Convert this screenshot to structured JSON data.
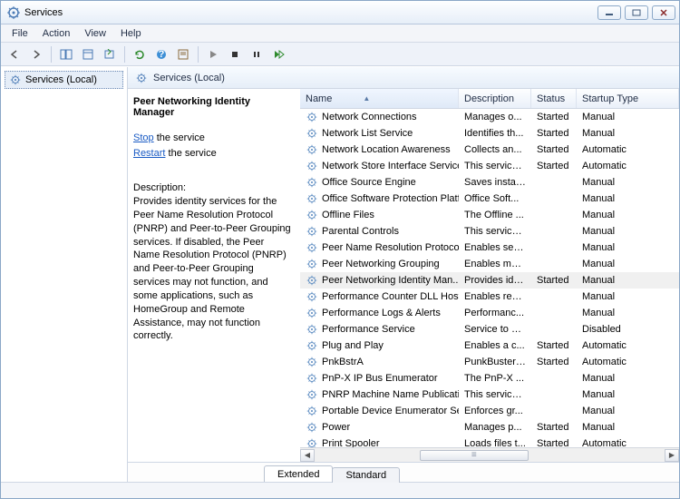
{
  "window": {
    "title": "Services"
  },
  "menu": {
    "file": "File",
    "action": "Action",
    "view": "View",
    "help": "Help"
  },
  "tree": {
    "root": "Services (Local)"
  },
  "panel_header": "Services (Local)",
  "detail": {
    "title": "Peer Networking Identity Manager",
    "stop_link": "Stop",
    "stop_suffix": " the service",
    "restart_link": "Restart",
    "restart_suffix": " the service",
    "desc_label": "Description:",
    "desc_text": "Provides identity services for the Peer Name Resolution Protocol (PNRP) and Peer-to-Peer Grouping services. If disabled, the Peer Name Resolution Protocol (PNRP) and Peer-to-Peer Grouping services may not function, and some applications, such as HomeGroup and Remote Assistance, may not function correctly."
  },
  "columns": {
    "name": "Name",
    "desc": "Description",
    "status": "Status",
    "startup": "Startup Type"
  },
  "tabs": {
    "extended": "Extended",
    "standard": "Standard"
  },
  "services": [
    {
      "name": "Network Connections",
      "desc": "Manages o...",
      "status": "Started",
      "startup": "Manual"
    },
    {
      "name": "Network List Service",
      "desc": "Identifies th...",
      "status": "Started",
      "startup": "Manual"
    },
    {
      "name": "Network Location Awareness",
      "desc": "Collects an...",
      "status": "Started",
      "startup": "Automatic"
    },
    {
      "name": "Network Store Interface Service",
      "desc": "This service ...",
      "status": "Started",
      "startup": "Automatic"
    },
    {
      "name": "Office  Source Engine",
      "desc": "Saves install...",
      "status": "",
      "startup": "Manual"
    },
    {
      "name": "Office Software Protection Platf...",
      "desc": "Office Soft...",
      "status": "",
      "startup": "Manual"
    },
    {
      "name": "Offline Files",
      "desc": "The Offline ...",
      "status": "",
      "startup": "Manual"
    },
    {
      "name": "Parental Controls",
      "desc": "This service ...",
      "status": "",
      "startup": "Manual"
    },
    {
      "name": "Peer Name Resolution Protocol",
      "desc": "Enables serv...",
      "status": "",
      "startup": "Manual"
    },
    {
      "name": "Peer Networking Grouping",
      "desc": "Enables mul...",
      "status": "",
      "startup": "Manual"
    },
    {
      "name": "Peer Networking Identity Man...",
      "desc": "Provides ide...",
      "status": "Started",
      "startup": "Manual",
      "sel": true
    },
    {
      "name": "Performance Counter DLL Host",
      "desc": "Enables rem...",
      "status": "",
      "startup": "Manual"
    },
    {
      "name": "Performance Logs & Alerts",
      "desc": "Performanc...",
      "status": "",
      "startup": "Manual"
    },
    {
      "name": "Performance Service",
      "desc": "Service to al...",
      "status": "",
      "startup": "Disabled"
    },
    {
      "name": "Plug and Play",
      "desc": "Enables a c...",
      "status": "Started",
      "startup": "Automatic"
    },
    {
      "name": "PnkBstrA",
      "desc": "PunkBuster ...",
      "status": "Started",
      "startup": "Automatic"
    },
    {
      "name": "PnP-X IP Bus Enumerator",
      "desc": "The PnP-X ...",
      "status": "",
      "startup": "Manual"
    },
    {
      "name": "PNRP Machine Name Publicati...",
      "desc": "This service ...",
      "status": "",
      "startup": "Manual"
    },
    {
      "name": "Portable Device Enumerator Ser...",
      "desc": "Enforces gr...",
      "status": "",
      "startup": "Manual"
    },
    {
      "name": "Power",
      "desc": "Manages p...",
      "status": "Started",
      "startup": "Manual"
    },
    {
      "name": "Print Spooler",
      "desc": "Loads files t...",
      "status": "Started",
      "startup": "Automatic"
    }
  ]
}
